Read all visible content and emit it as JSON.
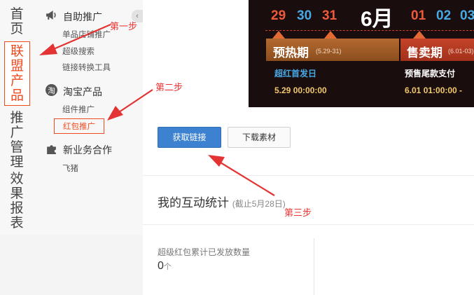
{
  "left_nav": {
    "items": [
      {
        "label": "首页"
      },
      {
        "label": "联盟产品",
        "active": true
      },
      {
        "label": "推广管理"
      },
      {
        "label": "效果报表"
      }
    ]
  },
  "collapse_glyph": "‹",
  "sub_nav": {
    "groups": [
      {
        "title": "自助推广",
        "icon": "megaphone-icon",
        "links": [
          "单品店铺推广",
          "超级搜索",
          "链接转换工具"
        ]
      },
      {
        "title": "淘宝产品",
        "icon": "taobao-icon",
        "icon_text": "淘",
        "links": [
          "组件推广",
          "红包推广"
        ]
      },
      {
        "title": "新业务合作",
        "icon": "puzzle-icon",
        "links": [
          "飞猪"
        ]
      }
    ]
  },
  "banner": {
    "dates": [
      "29",
      "30",
      "31",
      "01",
      "02",
      "03"
    ],
    "month": "6月",
    "presale": {
      "title": "预热期",
      "range": "(5.29-31)",
      "label": "超红首发日",
      "time": "5.29 00:00:00"
    },
    "sale": {
      "title": "售卖期",
      "range": "(6.01-03)",
      "label": "预售尾款支付",
      "time": "6.01 01:00:00 -"
    },
    "colors": {
      "red": "#ee5a3b",
      "blue": "#46a9e6",
      "gold": "#f1c96d"
    }
  },
  "actions": {
    "get_link": "获取链接",
    "download": "下载素材"
  },
  "stats": {
    "title": "我的互动统计",
    "note": "(截止5月28日)",
    "metric_label": "超级红包累计已发放数量",
    "metric_value": "0",
    "metric_unit": "个"
  },
  "annotations": {
    "step1": "第一步",
    "step2": "第二步",
    "step3": "第三步",
    "color": "#e33333"
  }
}
